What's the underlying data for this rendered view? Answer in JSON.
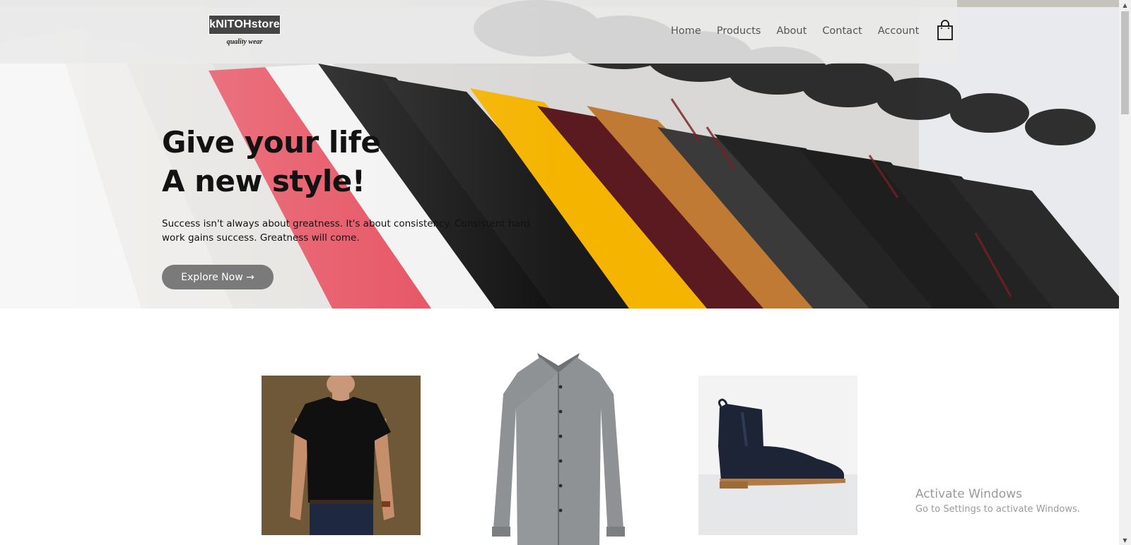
{
  "brand": {
    "logo_text": "kNITOHstore",
    "tagline": "quality wear"
  },
  "nav": {
    "items": [
      {
        "label": "Home"
      },
      {
        "label": "Products"
      },
      {
        "label": "About"
      },
      {
        "label": "Contact"
      },
      {
        "label": "Account"
      }
    ],
    "cart_icon": "shopping-bag-icon"
  },
  "hero": {
    "title_line1": "Give your life",
    "title_line2": "A new style!",
    "description": "Success isn't always about greatness. It's about consistency. Consistent hard work gains success. Greatness will come.",
    "button_label": "Explore Now →",
    "button_color": "#7a7a7a"
  },
  "products": [
    {
      "name": "black t-shirt",
      "icon": "tshirt-image"
    },
    {
      "name": "grey shirt",
      "icon": "shirt-image"
    },
    {
      "name": "navy chelsea boot",
      "icon": "boot-image"
    }
  ],
  "watermark": {
    "title": "Activate Windows",
    "subtitle": "Go to Settings to activate Windows."
  },
  "scrollbar": {
    "up_arrow": "▲",
    "down_arrow": "▼"
  }
}
